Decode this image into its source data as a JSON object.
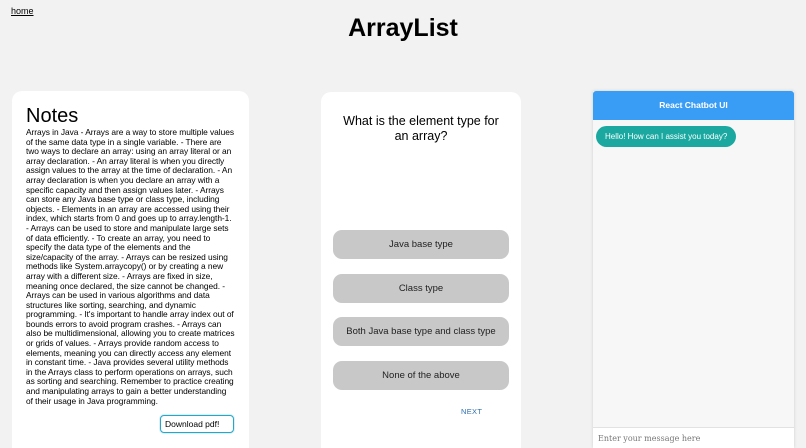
{
  "nav": {
    "home_label": "home"
  },
  "page": {
    "title": "ArrayList"
  },
  "notes": {
    "title": "Notes",
    "body": "Arrays in Java - Arrays are a way to store multiple values of the same data type in a single variable. - There are two ways to declare an array: using an array literal or an array declaration. - An array literal is when you directly assign values to the array at the time of declaration. - An array declaration is when you declare an array with a specific capacity and then assign values later. - Arrays can store any Java base type or class type, including objects. - Elements in an array are accessed using their index, which starts from 0 and goes up to array.length-1. - Arrays can be used to store and manipulate large sets of data efficiently. - To create an array, you need to specify the data type of the elements and the size/capacity of the array. - Arrays can be resized using methods like System.arraycopy() or by creating a new array with a different size. - Arrays are fixed in size, meaning once declared, the size cannot be changed. - Arrays can be used in various algorithms and data structures like sorting, searching, and dynamic programming. - It's important to handle array index out of bounds errors to avoid program crashes. - Arrays can also be multidimensional, allowing you to create matrices or grids of values. - Arrays provide random access to elements, meaning you can directly access any element in constant time. - Java provides several utility methods in the Arrays class to perform operations on arrays, such as sorting and searching. Remember to practice creating and manipulating arrays to gain a better understanding of their usage in Java programming.",
    "download_label": "Download pdf!"
  },
  "quiz": {
    "question": "What is the element type for an array?",
    "answers": [
      {
        "label": "Java base type"
      },
      {
        "label": "Class type"
      },
      {
        "label": "Both Java base type and class type"
      },
      {
        "label": "None of the above"
      }
    ],
    "next_label": "NEXT"
  },
  "chatbot": {
    "header": "React Chatbot UI",
    "messages": [
      {
        "text": "Hello! How can I assist you today?"
      }
    ],
    "input_placeholder": "Enter your message here"
  },
  "colors": {
    "chat_header": "#3a9df5",
    "chat_bubble": "#1aa8a0",
    "answer_button": "#c8c8c8",
    "download_border": "#27a6c9",
    "next_link": "#2f6fb0"
  }
}
